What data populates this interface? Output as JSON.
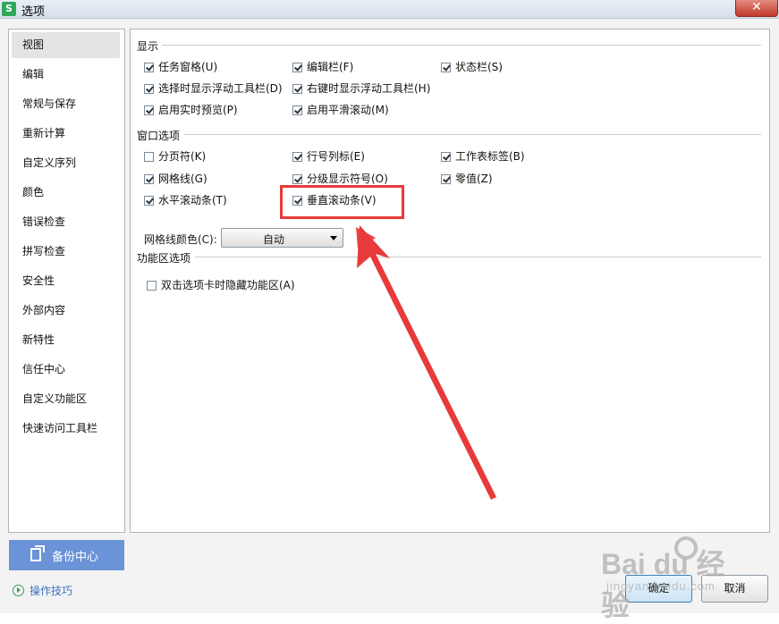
{
  "window": {
    "title": "选项",
    "app_icon": "S",
    "close": "✕"
  },
  "sidebar": {
    "items": [
      {
        "label": "视图",
        "selected": true
      },
      {
        "label": "编辑",
        "selected": false
      },
      {
        "label": "常规与保存",
        "selected": false
      },
      {
        "label": "重新计算",
        "selected": false
      },
      {
        "label": "自定义序列",
        "selected": false
      },
      {
        "label": "颜色",
        "selected": false
      },
      {
        "label": "错误检查",
        "selected": false
      },
      {
        "label": "拼写检查",
        "selected": false
      },
      {
        "label": "安全性",
        "selected": false
      },
      {
        "label": "外部内容",
        "selected": false
      },
      {
        "label": "新特性",
        "selected": false
      },
      {
        "label": "信任中心",
        "selected": false
      },
      {
        "label": "自定义功能区",
        "selected": false
      },
      {
        "label": "快速访问工具栏",
        "selected": false
      }
    ],
    "backup_button": "备份中心",
    "tips_link": "操作技巧"
  },
  "sections": {
    "display": {
      "title": "显示",
      "options": [
        {
          "label": "任务窗格(U)",
          "checked": true
        },
        {
          "label": "编辑栏(F)",
          "checked": true
        },
        {
          "label": "状态栏(S)",
          "checked": true
        },
        {
          "label": "选择时显示浮动工具栏(D)",
          "checked": true
        },
        {
          "label": "右键时显示浮动工具栏(H)",
          "checked": true
        },
        {
          "label": "启用实时预览(P)",
          "checked": true
        },
        {
          "label": "启用平滑滚动(M)",
          "checked": true
        }
      ]
    },
    "window_options": {
      "title": "窗口选项",
      "options": [
        {
          "label": "分页符(K)",
          "checked": false
        },
        {
          "label": "行号列标(E)",
          "checked": true
        },
        {
          "label": "工作表标签(B)",
          "checked": true
        },
        {
          "label": "网格线(G)",
          "checked": true
        },
        {
          "label": "分级显示符号(O)",
          "checked": true
        },
        {
          "label": "零值(Z)",
          "checked": true
        },
        {
          "label": "水平滚动条(T)",
          "checked": true
        },
        {
          "label": "垂直滚动条(V)",
          "checked": true
        }
      ],
      "gridline_color_label": "网格线颜色(C):",
      "gridline_color_value": "自动"
    },
    "ribbon": {
      "title": "功能区选项",
      "options": [
        {
          "label": "双击选项卡时隐藏功能区(A)",
          "checked": false
        }
      ]
    }
  },
  "buttons": {
    "ok": "确定",
    "cancel": "取消"
  },
  "watermark": {
    "main": "Bai du 经验",
    "sub": "jingyan.baidu.com"
  },
  "annotation": {
    "color": "#e83a3a"
  }
}
